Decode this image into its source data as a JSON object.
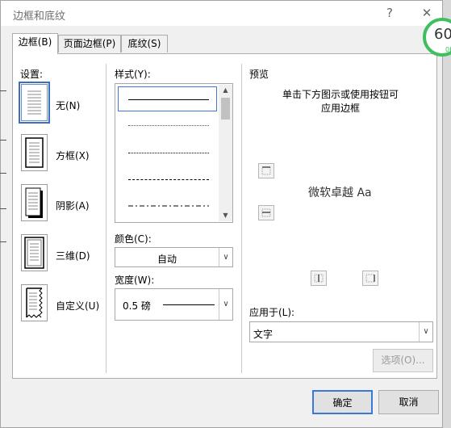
{
  "window": {
    "title": "边框和底纹",
    "help_glyph": "?",
    "close_glyph": "✕"
  },
  "tabs": [
    {
      "label": "边框(B)",
      "active": true
    },
    {
      "label": "页面边框(P)",
      "active": false
    },
    {
      "label": "底纹(S)",
      "active": false
    }
  ],
  "settings": {
    "header": "设置:",
    "items": [
      {
        "label": "无(N)",
        "icon": "no-border-icon",
        "selected": true
      },
      {
        "label": "方框(X)",
        "icon": "box-border-icon",
        "selected": false
      },
      {
        "label": "阴影(A)",
        "icon": "shadow-border-icon",
        "selected": false
      },
      {
        "label": "三维(D)",
        "icon": "3d-border-icon",
        "selected": false
      },
      {
        "label": "自定义(U)",
        "icon": "custom-border-icon",
        "selected": false
      }
    ]
  },
  "style": {
    "header": "样式(Y):",
    "options": [
      "solid",
      "dotted-fine",
      "dotted",
      "dashed",
      "dash-dot"
    ],
    "selected_index": 0
  },
  "color": {
    "label": "颜色(C):",
    "value": "自动"
  },
  "width": {
    "label": "宽度(W):",
    "value": "0.5 磅"
  },
  "preview": {
    "header": "预览",
    "hint_line1": "单击下方图示或使用按钮可",
    "hint_line2": "应用边框",
    "sample_text": "微软卓越  Aa"
  },
  "apply_to": {
    "label": "应用于(L):",
    "value": "文字"
  },
  "buttons": {
    "options": "选项(O)...",
    "ok": "确定",
    "cancel": "取消"
  },
  "badge": {
    "value": "60",
    "sub": "0K"
  },
  "colors": {
    "accent": "#3c6fbf",
    "badge_green": "#3fbf5f",
    "panel_bg": "#ffffff",
    "dialog_bg": "#f0f0f0"
  }
}
